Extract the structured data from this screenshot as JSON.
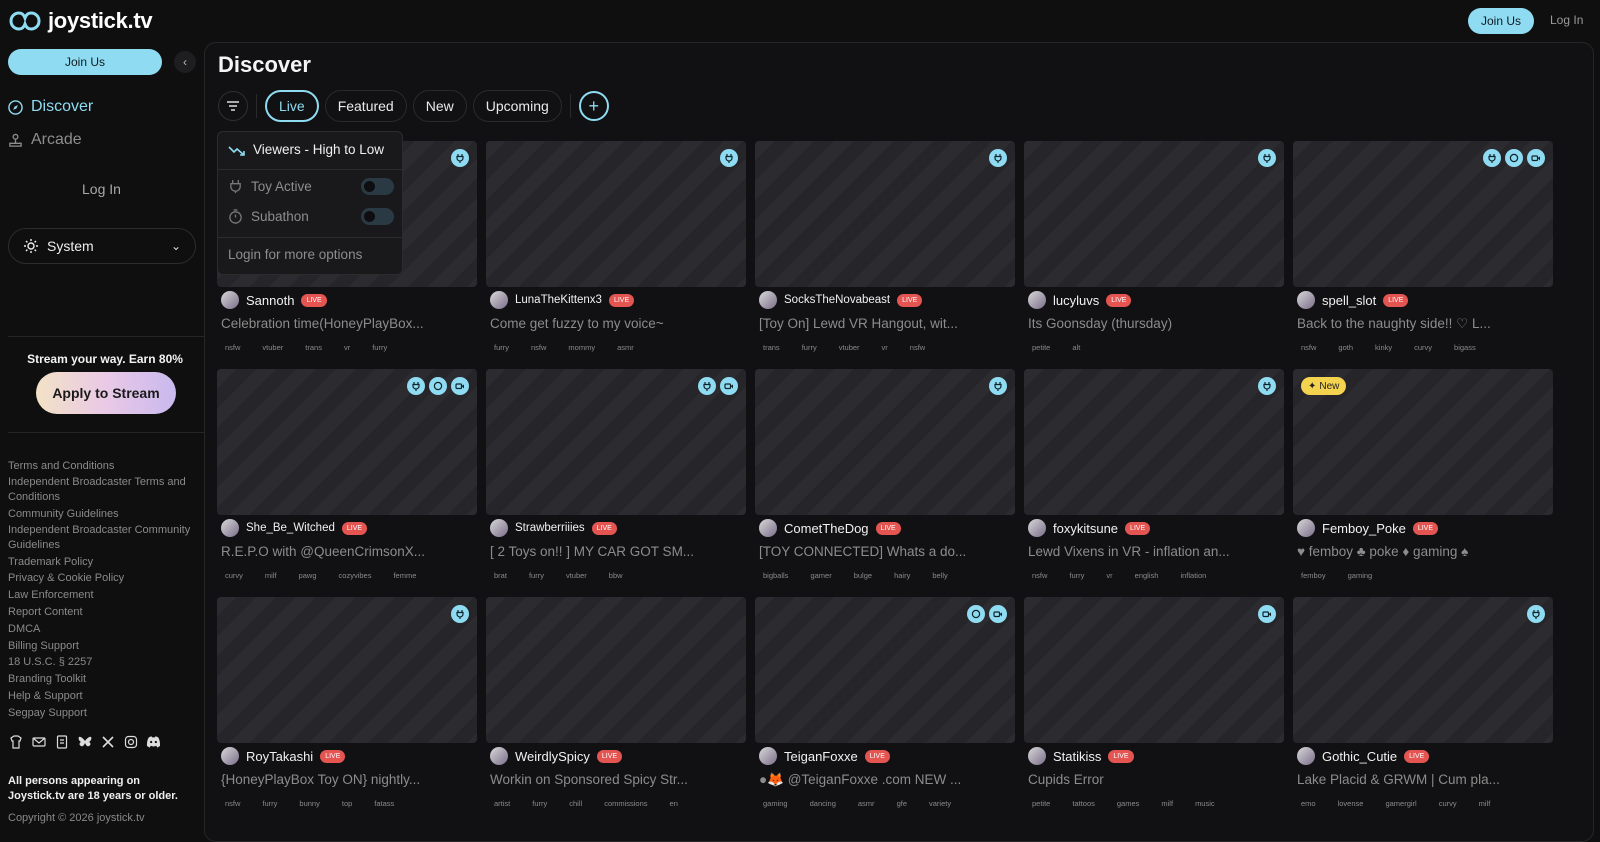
{
  "brand": {
    "name": "joystick.tv"
  },
  "topbar": {
    "join_label": "Join Us",
    "login_label": "Log In"
  },
  "sidebar": {
    "join_label": "Join Us",
    "nav": [
      {
        "label": "Discover",
        "icon": "compass-icon"
      },
      {
        "label": "Arcade",
        "icon": "joystick-icon"
      }
    ],
    "login_label": "Log In",
    "theme": "System",
    "promo_text": "Stream your way. Earn 80%",
    "apply_label": "Apply to Stream",
    "footer_links": [
      "Terms and Conditions",
      "Independent Broadcaster Terms and Conditions",
      "Community Guidelines",
      "Independent Broadcaster Community Guidelines",
      "Trademark Policy",
      "Privacy & Cookie Policy",
      "Law Enforcement",
      "Report Content",
      "DMCA",
      "Billing Support",
      "18 U.S.C. § 2257",
      "Branding Toolkit",
      "Help & Support",
      "Segpay Support"
    ],
    "legal": "All persons appearing on Joystick.tv are 18 years or older.",
    "copyright": "Copyright © 2026 joystick.tv"
  },
  "main": {
    "title": "Discover",
    "tabs": [
      "Live",
      "Featured",
      "New",
      "Upcoming"
    ],
    "active_tab": "Live"
  },
  "filter_menu": {
    "sort": "Viewers - High to Low",
    "toy_active": "Toy Active",
    "subathon": "Subathon",
    "login_hint": "Login for more options"
  },
  "live_label": "LIVE",
  "new_label": "New",
  "streams": [
    {
      "user": "Sannoth",
      "title": "Celebration time(HoneyPlayBox...",
      "tags": [
        "nsfw",
        "vtuber",
        "trans",
        "vr",
        "furry"
      ],
      "badges": [
        "toy"
      ]
    },
    {
      "user": "LunaTheKittenx3",
      "title": "Come get fuzzy to my voice~",
      "tags": [
        "furry",
        "nsfw",
        "mommy",
        "asmr"
      ],
      "badges": [
        "toy"
      ]
    },
    {
      "user": "SocksTheNovabeast",
      "title": "[Toy On] Lewd VR Hangout, wit...",
      "tags": [
        "trans",
        "furry",
        "vtuber",
        "vr",
        "nsfw"
      ],
      "badges": [
        "toy"
      ]
    },
    {
      "user": "lucyluvs",
      "title": "Its Goonsday (thursday)",
      "tags": [
        "petite",
        "alt"
      ],
      "badges": [
        "toy"
      ]
    },
    {
      "user": "spell_slot",
      "title": "Back to the naughty side!! ♡ L...",
      "tags": [
        "nsfw",
        "goth",
        "kinky",
        "curvy",
        "bigass"
      ],
      "badges": [
        "toy",
        "chat",
        "cam"
      ]
    },
    {
      "user": "She_Be_Witched",
      "title": "R.E.P.O with @QueenCrimsonX...",
      "tags": [
        "curvy",
        "milf",
        "pawg",
        "cozyvibes",
        "femme"
      ],
      "badges": [
        "toy",
        "chat",
        "cam"
      ]
    },
    {
      "user": "Strawberriiies",
      "title": "[ 2 Toys on!! ] MY CAR GOT SM...",
      "tags": [
        "brat",
        "furry",
        "vtuber",
        "bbw"
      ],
      "badges": [
        "toy",
        "cam"
      ]
    },
    {
      "user": "CometTheDog",
      "title": "[TOY CONNECTED] Whats a do...",
      "tags": [
        "bigballs",
        "gamer",
        "bulge",
        "hairy",
        "belly"
      ],
      "badges": [
        "toy"
      ]
    },
    {
      "user": "foxykitsune",
      "title": "Lewd Vixens in VR - inflation an...",
      "tags": [
        "nsfw",
        "furry",
        "vr",
        "english",
        "inflation"
      ],
      "badges": [
        "toy"
      ]
    },
    {
      "user": "Femboy_Poke",
      "title": "♥ femboy ♣ poke ♦ gaming ♠",
      "tags": [
        "femboy",
        "gaming"
      ],
      "badges": [],
      "is_new": true
    },
    {
      "user": "RoyTakashi",
      "title": "{HoneyPlayBox Toy ON} nightly...",
      "tags": [
        "nsfw",
        "furry",
        "bunny",
        "top",
        "fatass"
      ],
      "badges": [
        "toy"
      ]
    },
    {
      "user": "WeirdlySpicy",
      "title": "Workin on Sponsored Spicy Str...",
      "tags": [
        "artist",
        "furry",
        "chill",
        "commissions",
        "en"
      ],
      "badges": []
    },
    {
      "user": "TeiganFoxxe",
      "title": "●🦊 @TeiganFoxxe .com NEW ...",
      "tags": [
        "gaming",
        "dancing",
        "asmr",
        "gfe",
        "variety"
      ],
      "badges": [
        "chat",
        "cam"
      ]
    },
    {
      "user": "Statikiss",
      "title": "Cupids Error",
      "tags": [
        "petite",
        "tattoos",
        "games",
        "milf",
        "music"
      ],
      "badges": [
        "cam"
      ]
    },
    {
      "user": "Gothic_Cutie",
      "title": "Lake Placid & GRWM | Cum pla...",
      "tags": [
        "emo",
        "lovense",
        "gamergirl",
        "curvy",
        "milf"
      ],
      "badges": [
        "toy"
      ]
    }
  ],
  "colors": {
    "accent": "#8fdcf2",
    "live": "#e45552",
    "new": "#f4d34f"
  }
}
